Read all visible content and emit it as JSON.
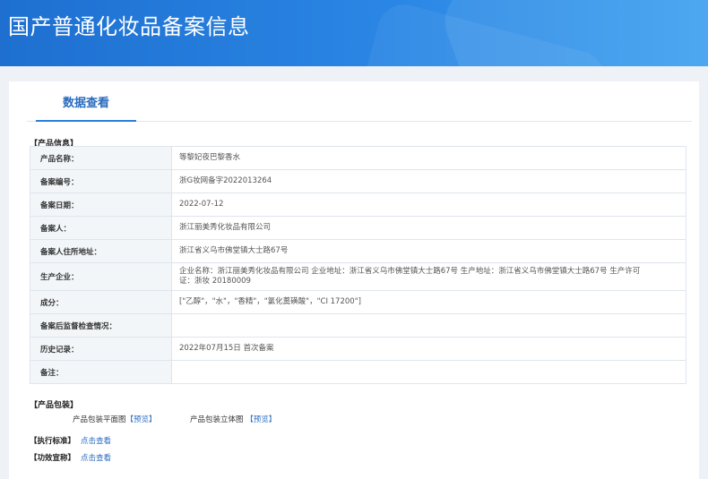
{
  "header": {
    "title": "国产普通化妆品备案信息"
  },
  "tabs": [
    {
      "label": "数据查看"
    }
  ],
  "product_info": {
    "section_label": "【产品信息】",
    "rows": [
      {
        "label": "产品名称：",
        "value": "等黎妃夜巴黎香水"
      },
      {
        "label": "备案编号：",
        "value": "浙G妆网备字2022013264"
      },
      {
        "label": "备案日期：",
        "value": "2022-07-12"
      },
      {
        "label": "备案人：",
        "value": "浙江丽美秀化妆品有限公司"
      },
      {
        "label": "备案人住所地址：",
        "value": "浙江省义乌市佛堂镇大士路67号"
      },
      {
        "label": "生产企业：",
        "value": "企业名称：浙江丽美秀化妆品有限公司 企业地址：浙江省义乌市佛堂镇大士路67号 生产地址：浙江省义乌市佛堂镇大士路67号 生产许可证：浙妆 20180009"
      },
      {
        "label": "成分：",
        "value": "[\"乙醇\"，\"水\"，\"香精\"，\"氯化薁磺酸\"，\"CI 17200\"]"
      },
      {
        "label": "备案后监督检查情况：",
        "value": ""
      },
      {
        "label": "历史记录：",
        "value": "2022年07月15日 首次备案"
      },
      {
        "label": "备注：",
        "value": ""
      }
    ]
  },
  "packaging": {
    "section_label": "【产品包装】",
    "flat_label": "产品包装平面图",
    "flat_link": "【预览】",
    "three_d_label": "产品包装立体图",
    "three_d_link": "【预览】"
  },
  "standard": {
    "label": "【执行标准】",
    "link": "点击查看"
  },
  "efficacy": {
    "label": "【功效宣称】",
    "link": "点击查看"
  }
}
